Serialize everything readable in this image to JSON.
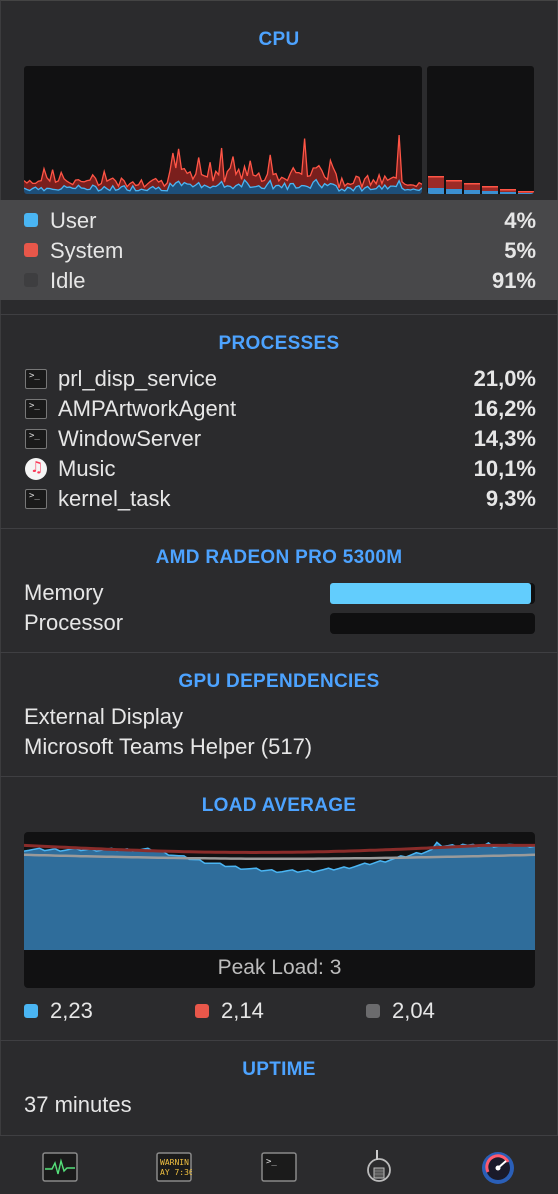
{
  "cpu": {
    "title": "CPU",
    "legend": [
      {
        "label": "User",
        "value": "4%",
        "color": "#4ab5f3"
      },
      {
        "label": "System",
        "value": "5%",
        "color": "#e8574a"
      },
      {
        "label": "Idle",
        "value": "91%",
        "color": "#3a3a3c"
      }
    ]
  },
  "processes": {
    "title": "PROCESSES",
    "items": [
      {
        "name": "prl_disp_service",
        "value": "21,0%",
        "icon": "terminal-icon"
      },
      {
        "name": "AMPArtworkAgent",
        "value": "16,2%",
        "icon": "terminal-icon"
      },
      {
        "name": "WindowServer",
        "value": "14,3%",
        "icon": "terminal-icon"
      },
      {
        "name": "Music",
        "value": "10,1%",
        "icon": "music-app-icon"
      },
      {
        "name": "kernel_task",
        "value": "9,3%",
        "icon": "terminal-icon"
      }
    ]
  },
  "gpu": {
    "title": "AMD RADEON PRO 5300M",
    "memory_label": "Memory",
    "memory_level": 0.98,
    "processor_label": "Processor",
    "processor_level": 0.0
  },
  "gpu_dependencies": {
    "title": "GPU DEPENDENCIES",
    "items": [
      "External Display",
      "Microsoft Teams Helper (517)"
    ]
  },
  "load_average": {
    "title": "LOAD AVERAGE",
    "peak_label": "Peak Load: 3",
    "values": [
      {
        "value": "2,23",
        "color": "#4ab5f3"
      },
      {
        "value": "2,14",
        "color": "#e8574a"
      },
      {
        "value": "2,04",
        "color": "#6b6b6d"
      }
    ]
  },
  "uptime": {
    "title": "UPTIME",
    "value": "37 minutes"
  },
  "dock": {
    "items": [
      "activity-monitor-icon",
      "console-icon",
      "terminal-icon",
      "system-information-icon",
      "istat-menus-icon"
    ],
    "console_text_1": "WARNIN",
    "console_text_2": "AY 7:36"
  }
}
